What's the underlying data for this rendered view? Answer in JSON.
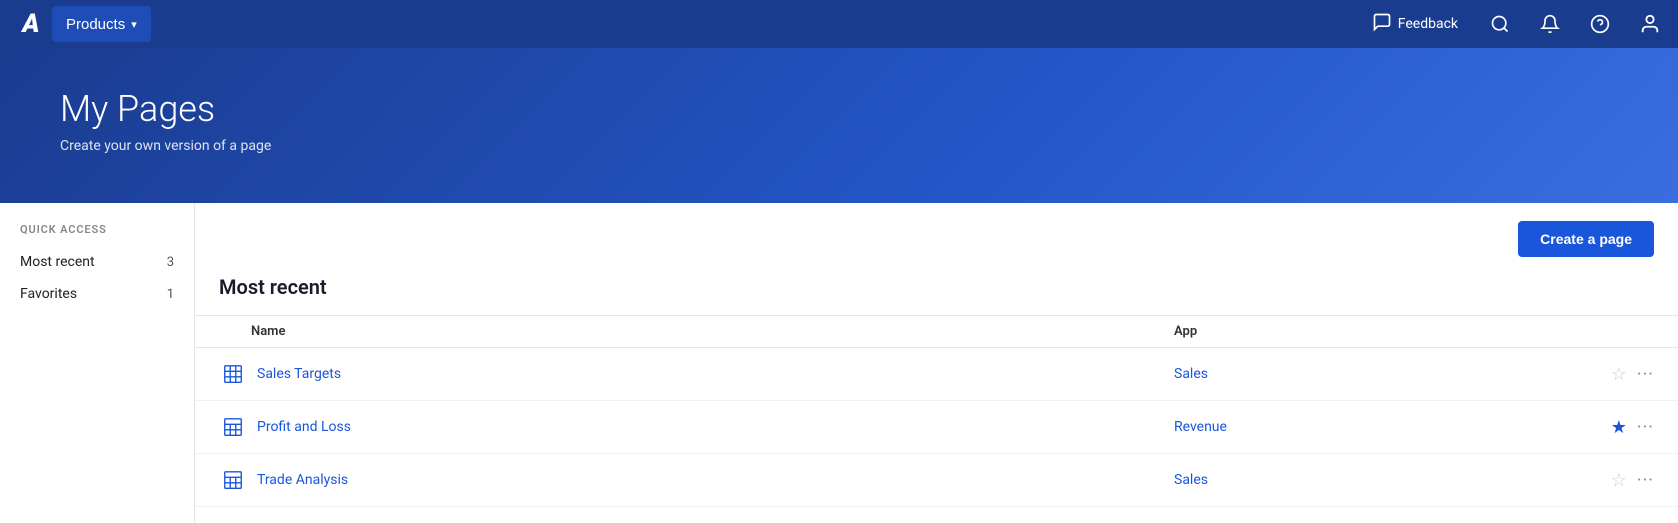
{
  "nav": {
    "logo_label": "A",
    "products_label": "Products",
    "feedback_label": "Feedback",
    "search_label": "search",
    "notifications_label": "notifications",
    "help_label": "help",
    "user_label": "user"
  },
  "hero": {
    "title": "My Pages",
    "subtitle": "Create your own version of a page"
  },
  "sidebar": {
    "section_label": "QUICK ACCESS",
    "items": [
      {
        "label": "Most recent",
        "count": "3"
      },
      {
        "label": "Favorites",
        "count": "1"
      }
    ]
  },
  "content": {
    "create_button_label": "Create a page",
    "section_title": "Most recent",
    "table_headers": {
      "name": "Name",
      "app": "App"
    },
    "rows": [
      {
        "name": "Sales Targets",
        "app": "Sales",
        "favorited": false
      },
      {
        "name": "Profit and Loss",
        "app": "Revenue",
        "favorited": true
      },
      {
        "name": "Trade Analysis",
        "app": "Sales",
        "favorited": false
      }
    ]
  },
  "icons": {
    "page_icon": "▦",
    "star_empty": "☆",
    "star_filled": "★",
    "more": "⋯",
    "chevron_down": "▾",
    "search": "🔍",
    "bell": "🔔",
    "question": "?",
    "user": "👤",
    "feedback_bubble": "💬"
  }
}
